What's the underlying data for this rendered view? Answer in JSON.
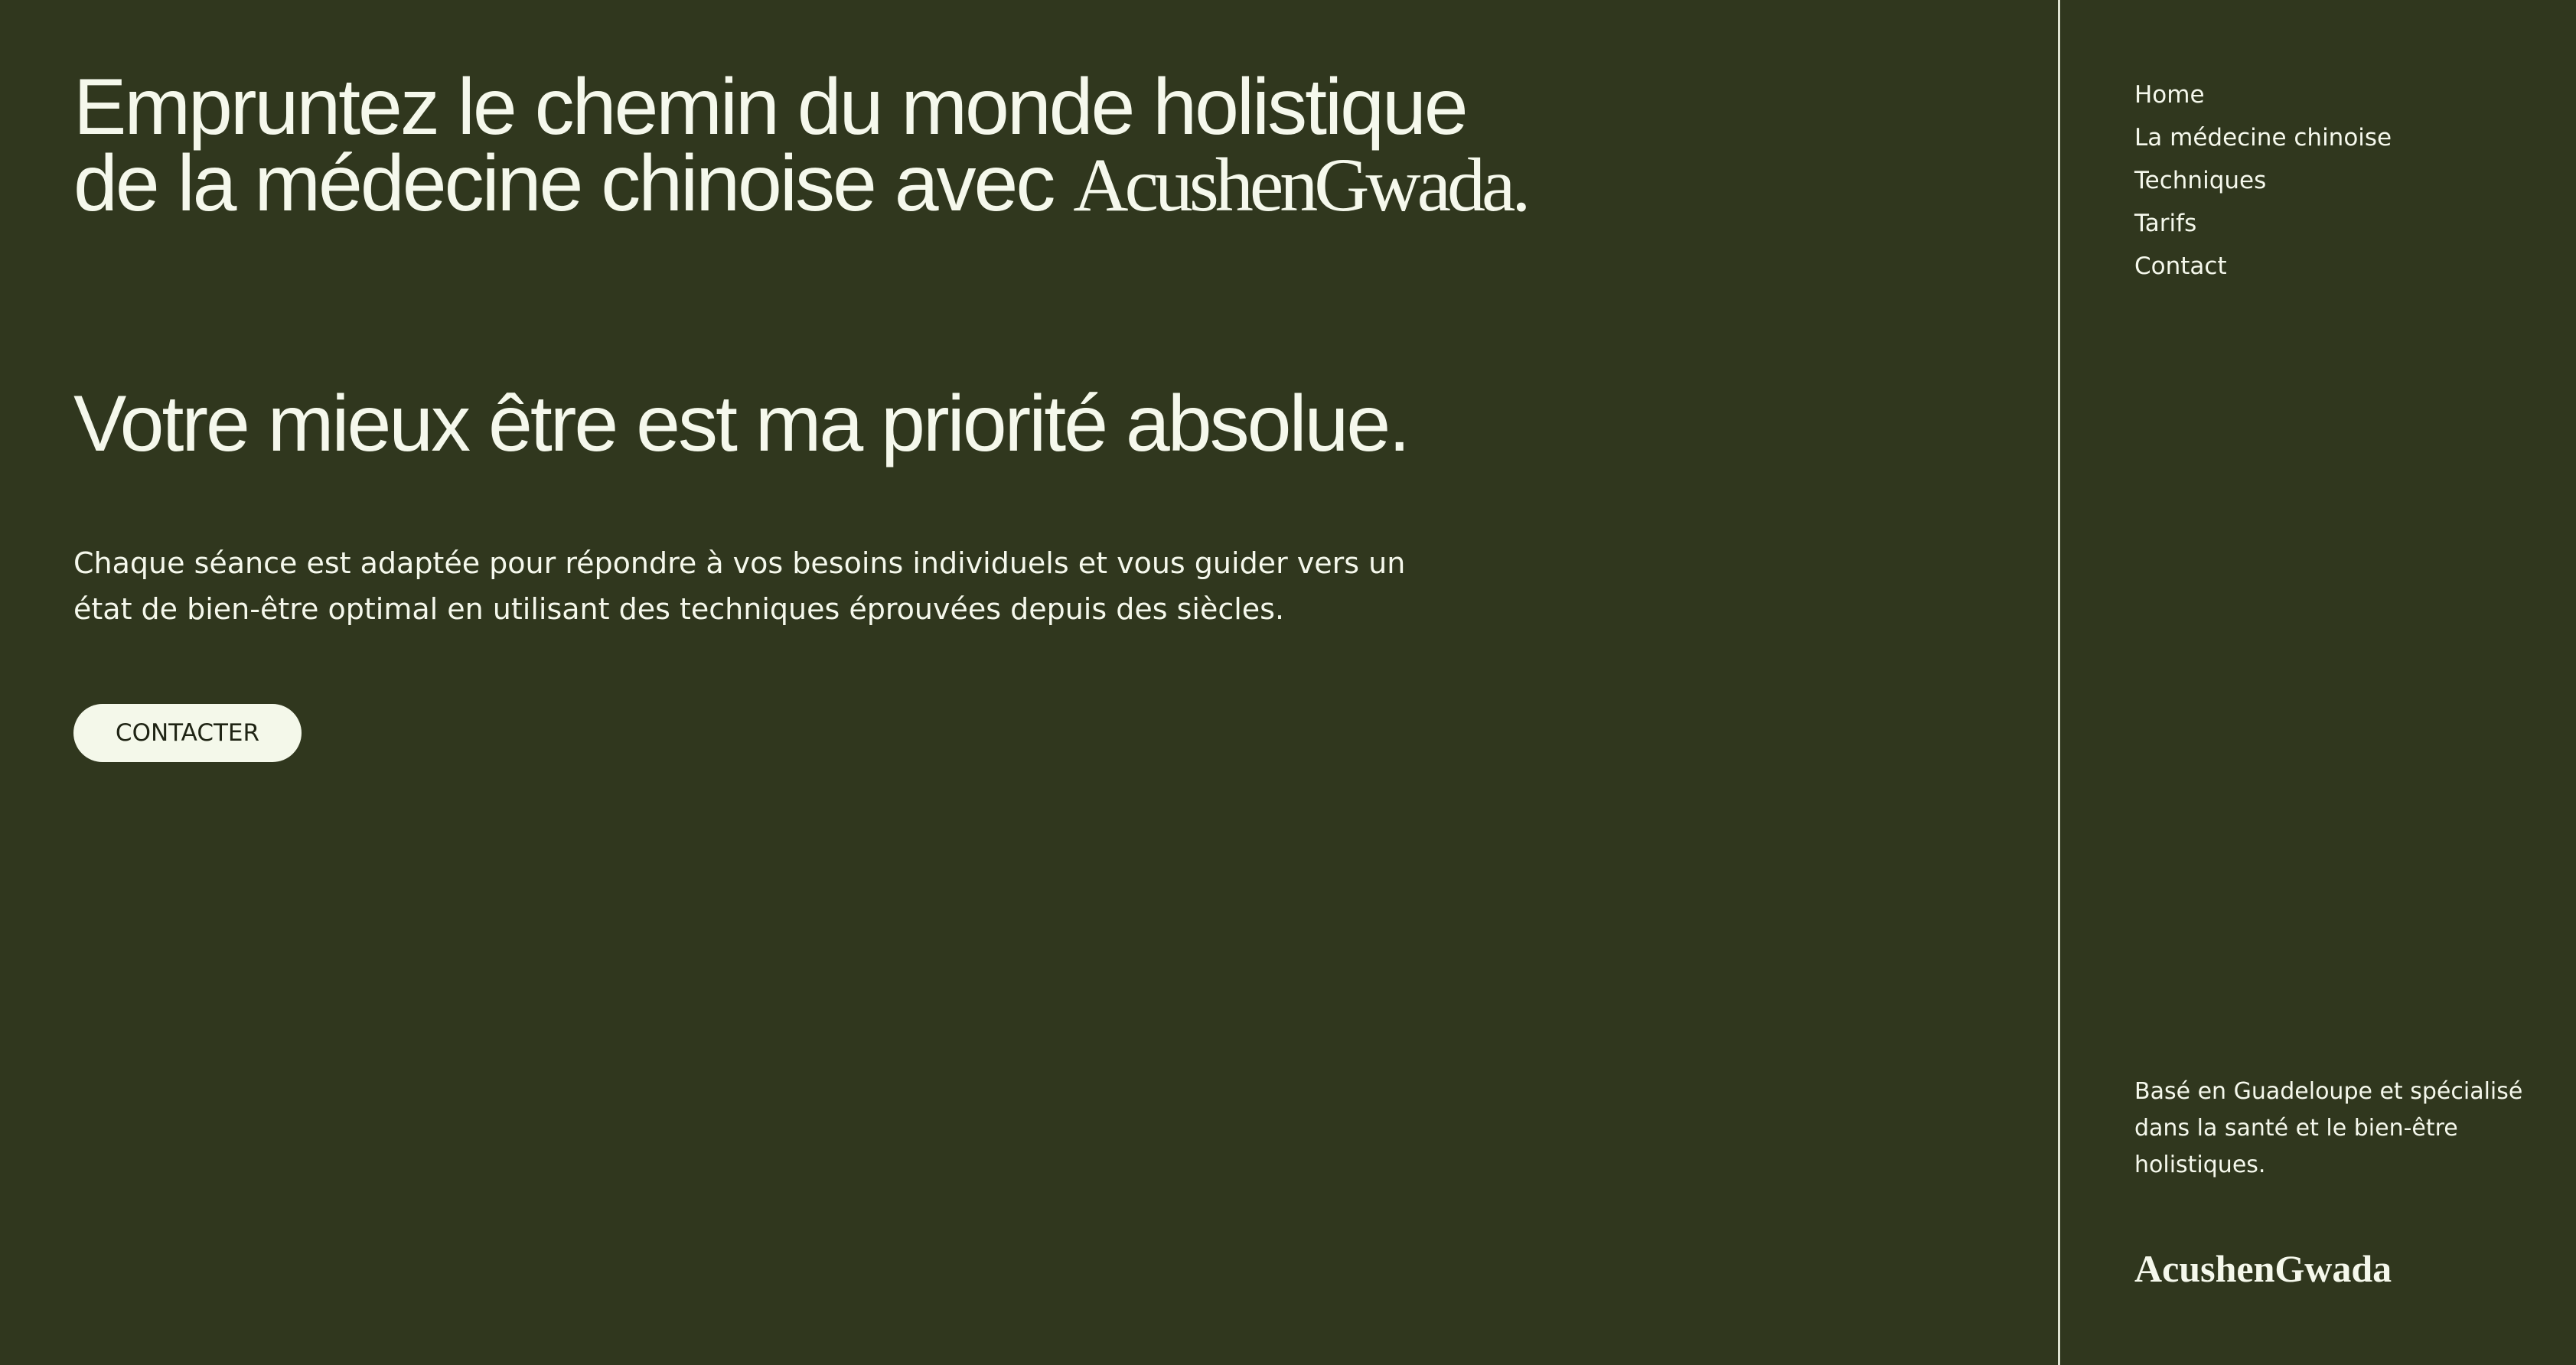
{
  "hero": {
    "headline": "Empruntez le chemin du monde holistique de la médecine chinoise avec",
    "brand": "AcushenGwada.",
    "subheadline": "Votre mieux être est ma priorité absolue.",
    "description": "Chaque séance est adaptée pour répondre à vos besoins individuels et vous guider vers un état de bien-être optimal en utilisant des techniques éprouvées depuis des siècles.",
    "cta_label": "CONTACTER"
  },
  "sidebar": {
    "nav": [
      {
        "label": "Home"
      },
      {
        "label": "La médecine chinoise"
      },
      {
        "label": "Techniques"
      },
      {
        "label": "Tarifs"
      },
      {
        "label": "Contact"
      }
    ],
    "about": "Basé en Guadeloupe et spécialisé dans la santé et le bien-être holistiques.",
    "brand": "AcushenGwada"
  },
  "colors": {
    "background": "#30371e",
    "text": "#f5f8ec",
    "button_bg": "#f4f8ea",
    "button_text": "#1f2414",
    "divider": "#dfe3d2"
  }
}
